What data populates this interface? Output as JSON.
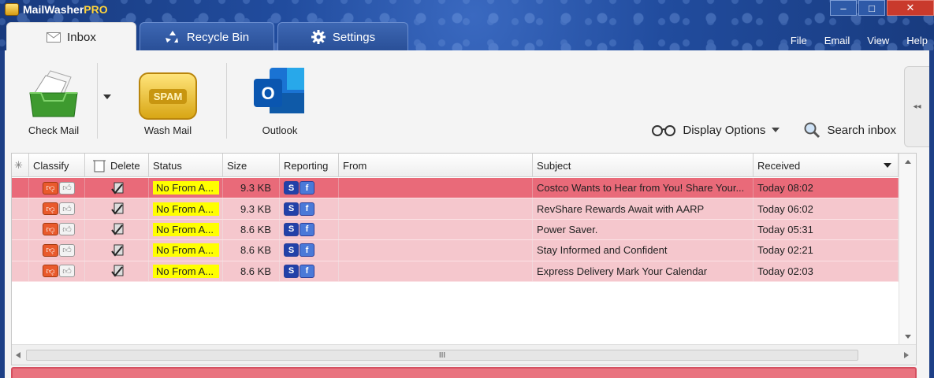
{
  "app": {
    "title_main": "MailWasher",
    "title_accent": "PRO"
  },
  "window_controls": {
    "minimize": "–",
    "maximize": "□",
    "close": "✕"
  },
  "tabs": [
    {
      "label": "Inbox",
      "icon": "envelope-icon",
      "active": true
    },
    {
      "label": "Recycle Bin",
      "icon": "recycle-icon",
      "active": false
    },
    {
      "label": "Settings",
      "icon": "gear-icon",
      "active": false
    }
  ],
  "menu": [
    "File",
    "Email",
    "View",
    "Help"
  ],
  "ribbon": {
    "check_mail": "Check Mail",
    "wash_mail": "Wash Mail",
    "spam_badge": "SPAM",
    "outlook": "Outlook",
    "display_options": "Display Options",
    "search_inbox": "Search inbox"
  },
  "columns": {
    "classify": "Classify",
    "delete": "Delete",
    "status": "Status",
    "size": "Size",
    "reporting": "Reporting",
    "from": "From",
    "subject": "Subject",
    "received": "Received"
  },
  "emails": [
    {
      "status": "No From A...",
      "size": "9.3 KB",
      "from": "",
      "subject": "Costco Wants to Hear from You! Share Your...",
      "received": "Today 08:02",
      "selected": true
    },
    {
      "status": "No From A...",
      "size": "9.3 KB",
      "from": "",
      "subject": "RevShare Rewards Await with AARP",
      "received": "Today 06:02",
      "selected": false
    },
    {
      "status": "No From A...",
      "size": "8.6 KB",
      "from": "",
      "subject": "Power Saver.",
      "received": "Today 05:31",
      "selected": false
    },
    {
      "status": "No From A...",
      "size": "8.6 KB",
      "from": "",
      "subject": "Stay Informed and Confident",
      "received": "Today 02:21",
      "selected": false
    },
    {
      "status": "No From A...",
      "size": "8.6 KB",
      "from": "",
      "subject": "Express Delivery Mark Your Calendar",
      "received": "Today 02:03",
      "selected": false
    }
  ],
  "scrollbar": {
    "thumb_grip": "III"
  },
  "colors": {
    "selected_row": "#e96a79",
    "row": "#f5c7cd",
    "status_bg": "#ffff00",
    "title_bar": "#214c9e"
  }
}
